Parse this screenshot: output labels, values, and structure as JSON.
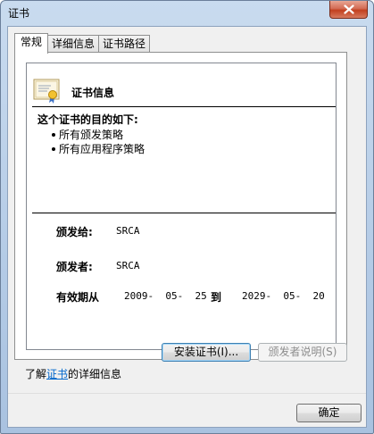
{
  "window": {
    "title": "证书"
  },
  "tabs": [
    {
      "label": "常规",
      "active": true
    },
    {
      "label": "详细信息",
      "active": false
    },
    {
      "label": "证书路径",
      "active": false
    }
  ],
  "cert": {
    "heading": "证书信息",
    "purpose_title": "这个证书的目的如下:",
    "purposes": [
      "所有颁发策略",
      "所有应用程序策略"
    ],
    "issued_to_label": "颁发给:",
    "issued_to_value": "SRCA",
    "issued_by_label": "颁发者:",
    "issued_by_value": "SRCA",
    "validity_label": "有效期从",
    "valid_from": "2009-  05-  25",
    "to_label": "到",
    "valid_to": "2029-  05-  20"
  },
  "buttons": {
    "install": "安装证书(I)...",
    "issuer_statement": "颁发者说明(S)",
    "ok": "确定"
  },
  "learn_more": {
    "prefix": "了解",
    "link": "证书",
    "suffix": "的详细信息"
  },
  "colors": {
    "link": "#0066cc",
    "close_button": "#c2401f"
  },
  "icons": {
    "close": "close-icon",
    "certificate": "certificate-icon"
  }
}
